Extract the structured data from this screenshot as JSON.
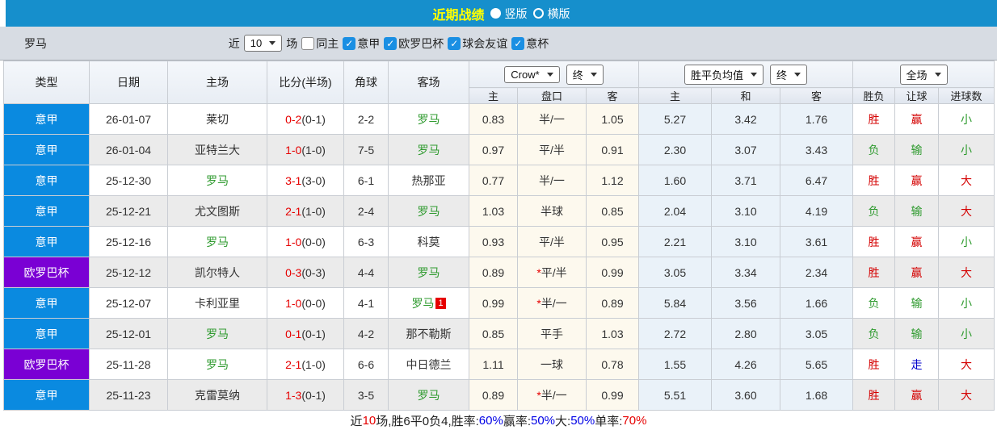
{
  "titlebar": {
    "title": "近期战绩",
    "layout_options": [
      {
        "label": "竖版",
        "selected": true
      },
      {
        "label": "横版",
        "selected": false
      }
    ]
  },
  "filterbar": {
    "team": "罗马",
    "recent_label": "近",
    "recent_value": "10",
    "matches_label": "场",
    "checkboxes": [
      {
        "label": "同主",
        "checked": false
      },
      {
        "label": "意甲",
        "checked": true
      },
      {
        "label": "欧罗巴杯",
        "checked": true
      },
      {
        "label": "球会友谊",
        "checked": true
      },
      {
        "label": "意杯",
        "checked": true
      }
    ]
  },
  "table": {
    "left_headers": [
      "类型",
      "日期",
      "主场",
      "比分(半场)",
      "角球",
      "客场"
    ],
    "odds_group": {
      "select1": "Crow*",
      "select2": "终",
      "columns": [
        "主",
        "盘口",
        "客"
      ]
    },
    "avg_group": {
      "select1": "胜平负均值",
      "select2": "终",
      "columns": [
        "主",
        "和",
        "客"
      ]
    },
    "result_group": {
      "select1": "全场",
      "columns": [
        "胜负",
        "让球",
        "进球数"
      ]
    },
    "rows": [
      {
        "type": "意甲",
        "type_class": "t-blue",
        "date": "26-01-07",
        "home": "莱切",
        "home_class": "",
        "score": "0-2",
        "half": "(0-1)",
        "corner": "2-2",
        "away": "罗马",
        "away_class": "roma",
        "away_badge": "",
        "star": "",
        "odds_home": "0.83",
        "handicap": "半/一",
        "odds_away": "1.05",
        "avg_home": "5.27",
        "avg_draw": "3.42",
        "avg_away": "1.76",
        "result": "胜",
        "result_class": "c-red",
        "spread": "赢",
        "spread_class": "c-red",
        "goal": "小",
        "goal_class": "c-green"
      },
      {
        "type": "意甲",
        "type_class": "t-blue",
        "date": "26-01-04",
        "home": "亚特兰大",
        "home_class": "",
        "score": "1-0",
        "half": "(1-0)",
        "corner": "7-5",
        "away": "罗马",
        "away_class": "roma",
        "away_badge": "",
        "star": "",
        "odds_home": "0.97",
        "handicap": "平/半",
        "odds_away": "0.91",
        "avg_home": "2.30",
        "avg_draw": "3.07",
        "avg_away": "3.43",
        "result": "负",
        "result_class": "c-green",
        "spread": "输",
        "spread_class": "c-green",
        "goal": "小",
        "goal_class": "c-green"
      },
      {
        "type": "意甲",
        "type_class": "t-blue",
        "date": "25-12-30",
        "home": "罗马",
        "home_class": "roma",
        "score": "3-1",
        "half": "(3-0)",
        "corner": "6-1",
        "away": "热那亚",
        "away_class": "",
        "away_badge": "",
        "star": "",
        "odds_home": "0.77",
        "handicap": "半/一",
        "odds_away": "1.12",
        "avg_home": "1.60",
        "avg_draw": "3.71",
        "avg_away": "6.47",
        "result": "胜",
        "result_class": "c-red",
        "spread": "赢",
        "spread_class": "c-red",
        "goal": "大",
        "goal_class": "c-red"
      },
      {
        "type": "意甲",
        "type_class": "t-blue",
        "date": "25-12-21",
        "home": "尤文图斯",
        "home_class": "",
        "score": "2-1",
        "half": "(1-0)",
        "corner": "2-4",
        "away": "罗马",
        "away_class": "roma",
        "away_badge": "",
        "star": "",
        "odds_home": "1.03",
        "handicap": "半球",
        "odds_away": "0.85",
        "avg_home": "2.04",
        "avg_draw": "3.10",
        "avg_away": "4.19",
        "result": "负",
        "result_class": "c-green",
        "spread": "输",
        "spread_class": "c-green",
        "goal": "大",
        "goal_class": "c-red"
      },
      {
        "type": "意甲",
        "type_class": "t-blue",
        "date": "25-12-16",
        "home": "罗马",
        "home_class": "roma",
        "score": "1-0",
        "half": "(0-0)",
        "corner": "6-3",
        "away": "科莫",
        "away_class": "",
        "away_badge": "",
        "star": "",
        "odds_home": "0.93",
        "handicap": "平/半",
        "odds_away": "0.95",
        "avg_home": "2.21",
        "avg_draw": "3.10",
        "avg_away": "3.61",
        "result": "胜",
        "result_class": "c-red",
        "spread": "赢",
        "spread_class": "c-red",
        "goal": "小",
        "goal_class": "c-green"
      },
      {
        "type": "欧罗巴杯",
        "type_class": "t-purple",
        "date": "25-12-12",
        "home": "凯尔特人",
        "home_class": "",
        "score": "0-3",
        "half": "(0-3)",
        "corner": "4-4",
        "away": "罗马",
        "away_class": "roma",
        "away_badge": "",
        "star": "*",
        "odds_home": "0.89",
        "handicap": "平/半",
        "odds_away": "0.99",
        "avg_home": "3.05",
        "avg_draw": "3.34",
        "avg_away": "2.34",
        "result": "胜",
        "result_class": "c-red",
        "spread": "赢",
        "spread_class": "c-red",
        "goal": "大",
        "goal_class": "c-red"
      },
      {
        "type": "意甲",
        "type_class": "t-blue",
        "date": "25-12-07",
        "home": "卡利亚里",
        "home_class": "",
        "score": "1-0",
        "half": "(0-0)",
        "corner": "4-1",
        "away": "罗马",
        "away_class": "roma",
        "away_badge": "1",
        "star": "*",
        "odds_home": "0.99",
        "handicap": "半/一",
        "odds_away": "0.89",
        "avg_home": "5.84",
        "avg_draw": "3.56",
        "avg_away": "1.66",
        "result": "负",
        "result_class": "c-green",
        "spread": "输",
        "spread_class": "c-green",
        "goal": "小",
        "goal_class": "c-green"
      },
      {
        "type": "意甲",
        "type_class": "t-blue",
        "date": "25-12-01",
        "home": "罗马",
        "home_class": "roma",
        "score": "0-1",
        "half": "(0-1)",
        "corner": "4-2",
        "away": "那不勒斯",
        "away_class": "",
        "away_badge": "",
        "star": "",
        "odds_home": "0.85",
        "handicap": "平手",
        "odds_away": "1.03",
        "avg_home": "2.72",
        "avg_draw": "2.80",
        "avg_away": "3.05",
        "result": "负",
        "result_class": "c-green",
        "spread": "输",
        "spread_class": "c-green",
        "goal": "小",
        "goal_class": "c-green"
      },
      {
        "type": "欧罗巴杯",
        "type_class": "t-purple",
        "date": "25-11-28",
        "home": "罗马",
        "home_class": "roma",
        "score": "2-1",
        "half": "(1-0)",
        "corner": "6-6",
        "away": "中日德兰",
        "away_class": "",
        "away_badge": "",
        "star": "",
        "odds_home": "1.11",
        "handicap": "一球",
        "odds_away": "0.78",
        "avg_home": "1.55",
        "avg_draw": "4.26",
        "avg_away": "5.65",
        "result": "胜",
        "result_class": "c-red",
        "spread": "走",
        "spread_class": "c-blue",
        "goal": "大",
        "goal_class": "c-red"
      },
      {
        "type": "意甲",
        "type_class": "t-blue",
        "date": "25-11-23",
        "home": "克雷莫纳",
        "home_class": "",
        "score": "1-3",
        "half": "(0-1)",
        "corner": "3-5",
        "away": "罗马",
        "away_class": "roma",
        "away_badge": "",
        "star": "*",
        "odds_home": "0.89",
        "handicap": "半/一",
        "odds_away": "0.99",
        "avg_home": "5.51",
        "avg_draw": "3.60",
        "avg_away": "1.68",
        "result": "胜",
        "result_class": "c-red",
        "spread": "赢",
        "spread_class": "c-red",
        "goal": "大",
        "goal_class": "c-red"
      }
    ],
    "star_legend": "*"
  },
  "summary": {
    "parts": [
      {
        "text": "近",
        "cls": "c-dark"
      },
      {
        "text": "10",
        "cls": "c-red2"
      },
      {
        "text": "场,胜6平0负4, ",
        "cls": "c-dark"
      },
      {
        "text": "胜率:",
        "cls": "c-dark"
      },
      {
        "text": "60%",
        "cls": "c-blue2"
      },
      {
        "text": " 赢率:",
        "cls": "c-dark"
      },
      {
        "text": "50%",
        "cls": "c-blue2"
      },
      {
        "text": " 大:",
        "cls": "c-dark"
      },
      {
        "text": "50%",
        "cls": "c-blue2"
      },
      {
        "text": " 单率:",
        "cls": "c-dark"
      },
      {
        "text": "70%",
        "cls": "c-red2"
      }
    ]
  },
  "colors": {
    "topbar_bg": "#168fcc",
    "title_yellow": "#ffff00",
    "league_blue": "#0a8ae0",
    "league_purple": "#7a00d4",
    "roma_green": "#2e9a2e",
    "score_red": "#e60000",
    "push_blue": "#0000cc",
    "rate_blue": "#0000e6",
    "odds_section_bg": "#fdf9ee",
    "avg_section_bg": "#eaf2f9",
    "filterbar_bg": "#d7dce3"
  }
}
